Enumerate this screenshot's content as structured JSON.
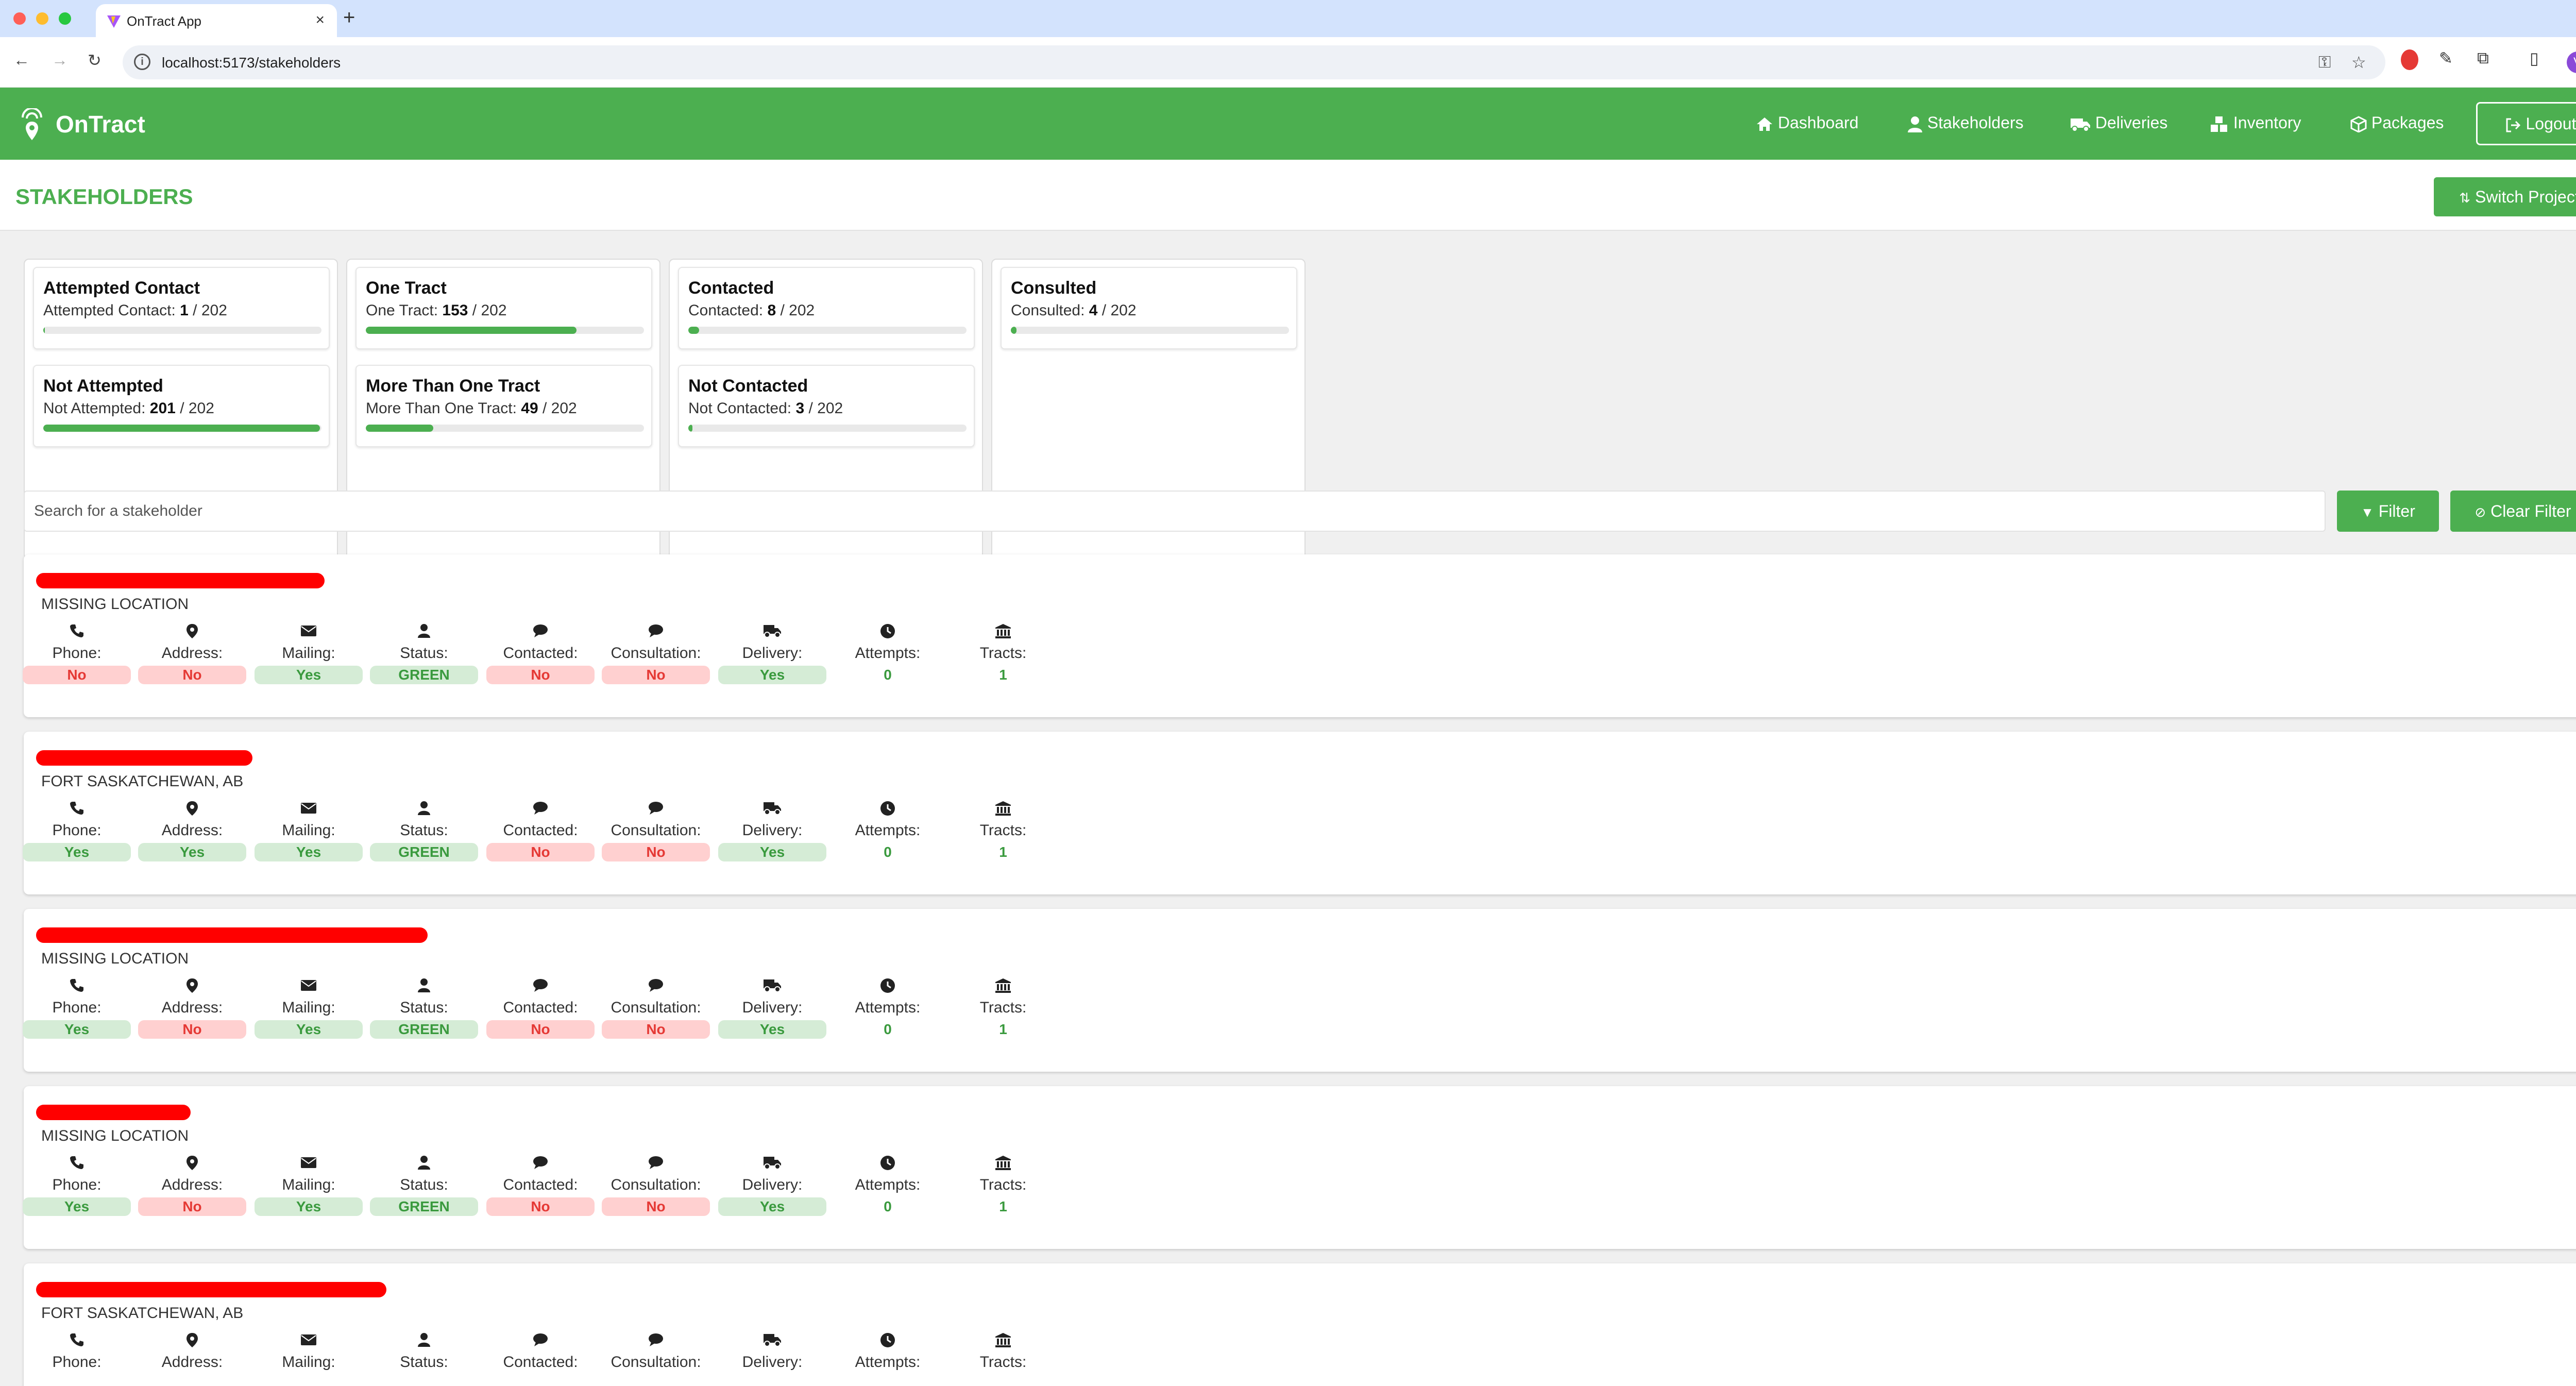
{
  "browser": {
    "tab_title": "OnTract App",
    "url": "localhost:5173/stakeholders",
    "profile_initial": "V"
  },
  "navbar": {
    "brand": "OnTract",
    "items": [
      {
        "label": "Dashboard",
        "icon": "home-icon"
      },
      {
        "label": "Stakeholders",
        "icon": "user-icon"
      },
      {
        "label": "Deliveries",
        "icon": "truck-icon"
      },
      {
        "label": "Inventory",
        "icon": "boxes-icon"
      },
      {
        "label": "Packages",
        "icon": "package-icon"
      }
    ],
    "logout": "Logout"
  },
  "header": {
    "title": "STAKEHOLDERS",
    "switch_project": "Switch Project"
  },
  "stats": {
    "columns": [
      [
        {
          "title": "Attempted Contact",
          "label": "Attempted Contact:",
          "value": 1,
          "total": 202
        },
        {
          "title": "Not Attempted",
          "label": "Not Attempted:",
          "value": 201,
          "total": 202
        }
      ],
      [
        {
          "title": "One Tract",
          "label": "One Tract:",
          "value": 153,
          "total": 202
        },
        {
          "title": "More Than One Tract",
          "label": "More Than One Tract:",
          "value": 49,
          "total": 202
        }
      ],
      [
        {
          "title": "Contacted",
          "label": "Contacted:",
          "value": 8,
          "total": 202
        },
        {
          "title": "Not Contacted",
          "label": "Not Contacted:",
          "value": 3,
          "total": 202
        }
      ],
      [
        {
          "title": "Consulted",
          "label": "Consulted:",
          "value": 4,
          "total": 202
        }
      ]
    ]
  },
  "search": {
    "placeholder": "Search for a stakeholder",
    "filter": "Filter",
    "clear_filter": "Clear Filter"
  },
  "field_labels": [
    "Phone:",
    "Address:",
    "Mailing:",
    "Status:",
    "Contacted:",
    "Consultation:",
    "Delivery:",
    "Attempts:",
    "Tracts:"
  ],
  "field_icons": [
    "phone-icon",
    "map-pin-icon",
    "envelope-icon",
    "user-icon",
    "comment-icon",
    "comment-icon",
    "truck-icon",
    "clock-icon",
    "landmark-icon"
  ],
  "stakeholders": [
    {
      "location": "MISSING LOCATION",
      "phone": "No",
      "address": "No",
      "mailing": "Yes",
      "status": "GREEN",
      "contacted": "No",
      "consultation": "No",
      "delivery": "Yes",
      "attempts": "0",
      "tracts": "1",
      "redaction_fraction": 0.56
    },
    {
      "location": "FORT SASKATCHEWAN, AB",
      "phone": "Yes",
      "address": "Yes",
      "mailing": "Yes",
      "status": "GREEN",
      "contacted": "No",
      "consultation": "No",
      "delivery": "Yes",
      "attempts": "0",
      "tracts": "1",
      "redaction_fraction": 0.42
    },
    {
      "location": "MISSING LOCATION",
      "phone": "Yes",
      "address": "No",
      "mailing": "Yes",
      "status": "GREEN",
      "contacted": "No",
      "consultation": "No",
      "delivery": "Yes",
      "attempts": "0",
      "tracts": "1",
      "redaction_fraction": 0.76
    },
    {
      "location": "MISSING LOCATION",
      "phone": "Yes",
      "address": "No",
      "mailing": "Yes",
      "status": "GREEN",
      "contacted": "No",
      "consultation": "No",
      "delivery": "Yes",
      "attempts": "0",
      "tracts": "1",
      "redaction_fraction": 0.3
    },
    {
      "location": "FORT SASKATCHEWAN, AB",
      "phone": "",
      "address": "",
      "mailing": "",
      "status": "",
      "contacted": "",
      "consultation": "",
      "delivery": "",
      "attempts": "",
      "tracts": "",
      "redaction_fraction": 0.68
    }
  ]
}
